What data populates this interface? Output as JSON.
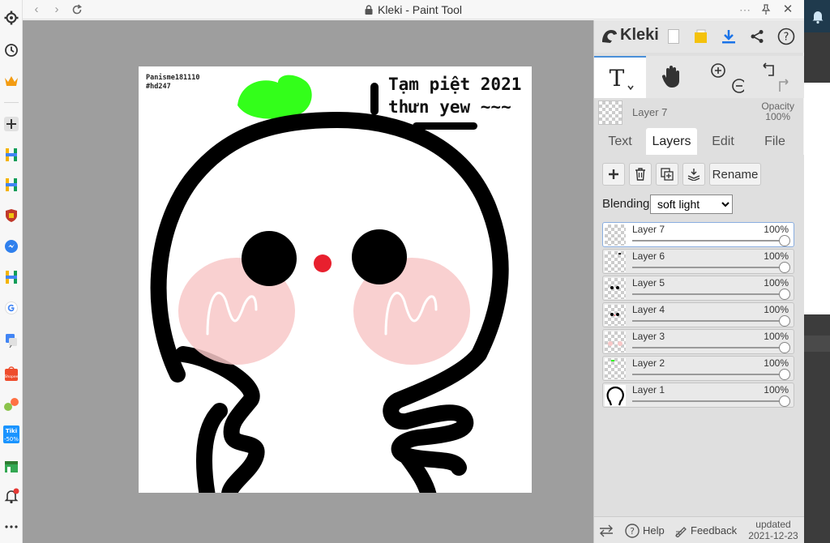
{
  "window": {
    "title": "Kleki - Paint Tool"
  },
  "canvas": {
    "watermark_line1": "Panisme181110",
    "watermark_line2": "#hd247",
    "message": "Tạm piệt 2021\nthưn yew ~~~"
  },
  "kleki": {
    "logo": "Kleki",
    "current_layer": {
      "name": "Layer 7",
      "opacity_label": "Opacity",
      "opacity_value": "100%"
    },
    "tabs": [
      {
        "label": "Text",
        "active": false
      },
      {
        "label": "Layers",
        "active": true
      },
      {
        "label": "Edit",
        "active": false
      },
      {
        "label": "File",
        "active": false
      }
    ],
    "rename_label": "Rename",
    "blending_label": "Blending",
    "blending_value": "soft light",
    "blending_options": [
      "soft light"
    ],
    "layers": [
      {
        "name": "Layer 7",
        "opacity": "100%",
        "active": true
      },
      {
        "name": "Layer 6",
        "opacity": "100%",
        "active": false
      },
      {
        "name": "Layer 5",
        "opacity": "100%",
        "active": false
      },
      {
        "name": "Layer 4",
        "opacity": "100%",
        "active": false
      },
      {
        "name": "Layer 3",
        "opacity": "100%",
        "active": false
      },
      {
        "name": "Layer 2",
        "opacity": "100%",
        "active": false
      },
      {
        "name": "Layer 1",
        "opacity": "100%",
        "active": false
      }
    ],
    "bottom": {
      "help_label": "Help",
      "feedback_label": "Feedback",
      "updated_label": "updated",
      "updated_date": "2021-12-23"
    }
  },
  "colors": {
    "brand_download": "#1a73e8",
    "leaf_green": "#33ff1a",
    "nose_red": "#e8202e",
    "cheek_pink": "#f8c8c8"
  }
}
